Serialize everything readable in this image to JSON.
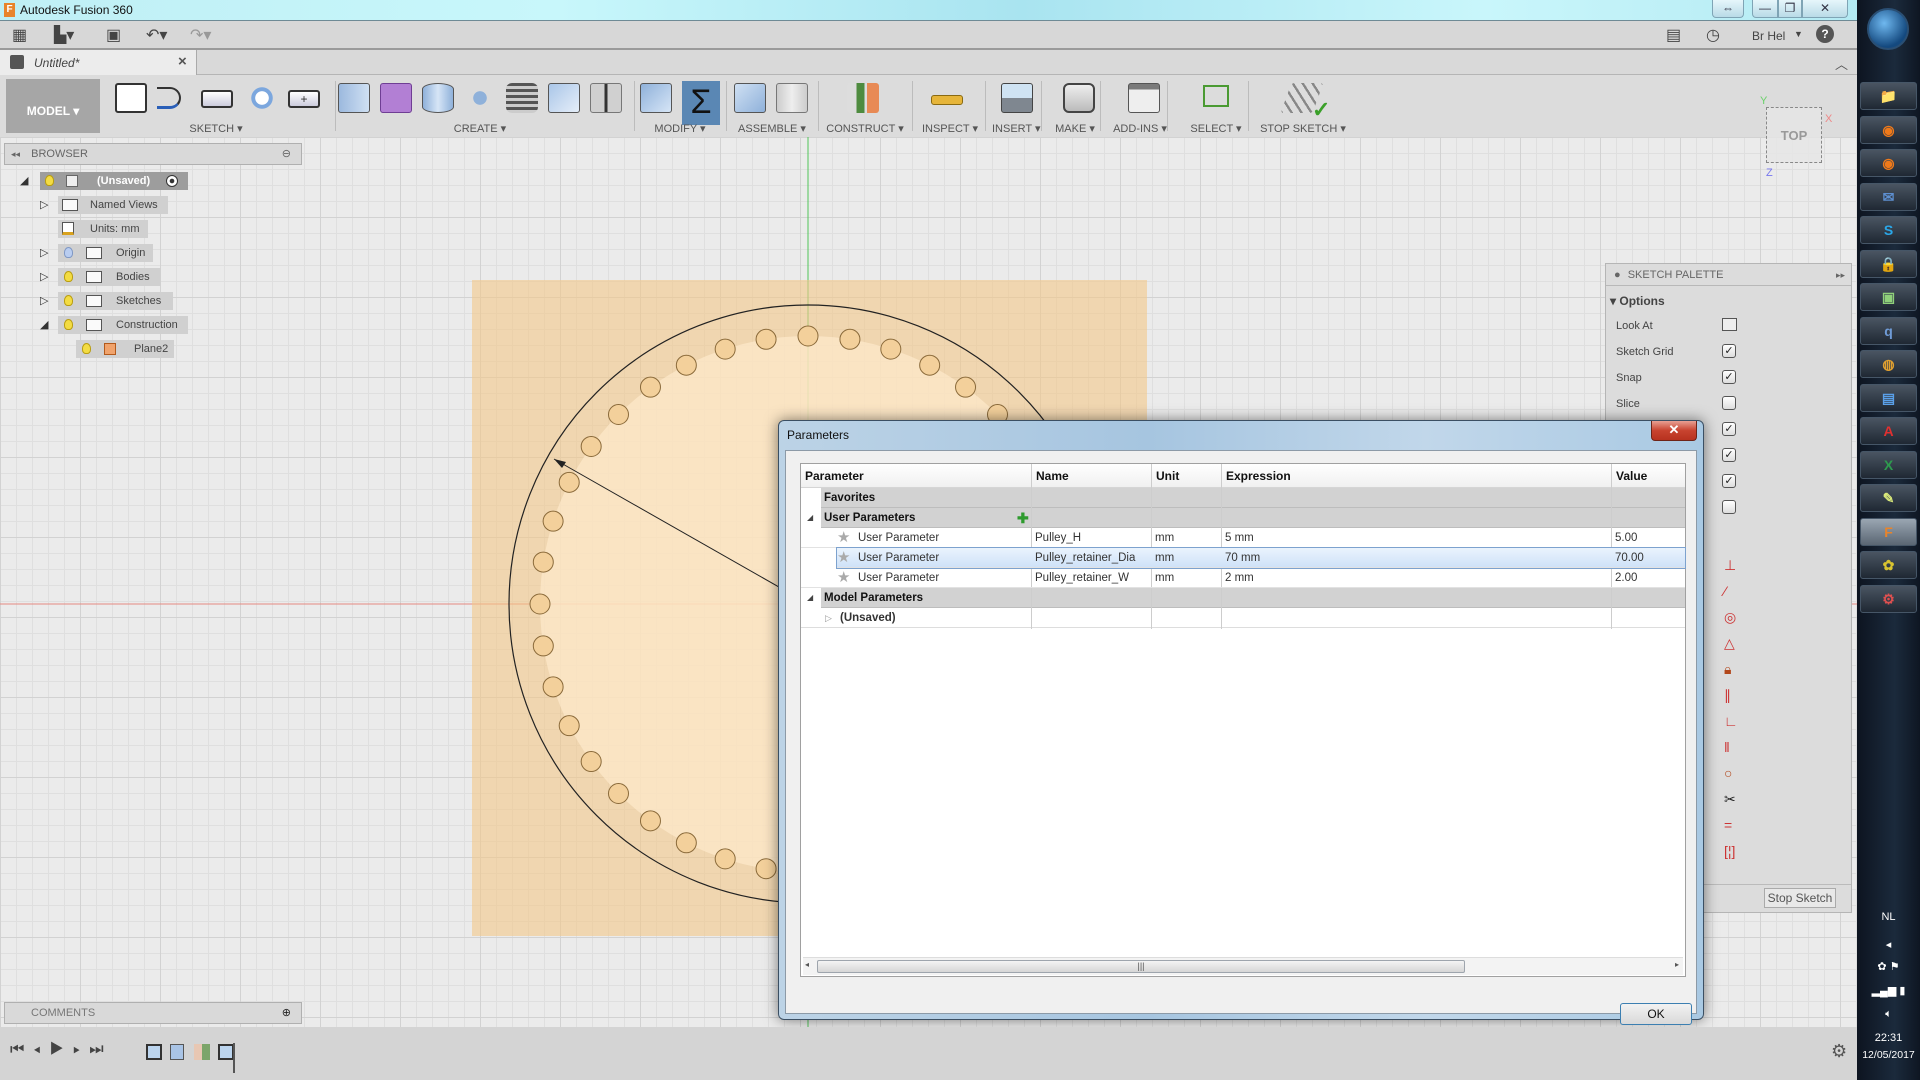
{
  "window": {
    "title": "Autodesk Fusion 360",
    "controls": {
      "restore_horizontal": "⇔",
      "minimize": "—",
      "maximize": "❐",
      "close": "✕"
    }
  },
  "appbar": {
    "user": "Br Hel",
    "icons": [
      "apps-grid-icon",
      "file-icon",
      "save-icon",
      "undo-icon",
      "redo-icon",
      "comment-icon",
      "history-icon",
      "help-icon"
    ]
  },
  "tab": {
    "label": "Untitled*",
    "close": "×"
  },
  "toolbar": {
    "workspace": "MODEL",
    "groups": [
      {
        "label": "SKETCH"
      },
      {
        "label": "CREATE"
      },
      {
        "label": "MODIFY"
      },
      {
        "label": "ASSEMBLE"
      },
      {
        "label": "CONSTRUCT"
      },
      {
        "label": "INSPECT"
      },
      {
        "label": "INSERT"
      },
      {
        "label": "MAKE"
      },
      {
        "label": "ADD-INS"
      },
      {
        "label": "SELECT"
      },
      {
        "label": "STOP SKETCH"
      }
    ],
    "active_tool": "Parameters (Σ)"
  },
  "browser": {
    "title": "BROWSER",
    "items": [
      {
        "label": "(Unsaved)",
        "level": 0,
        "expanded": true
      },
      {
        "label": "Named Views",
        "level": 1
      },
      {
        "label": "Units: mm",
        "level": 1
      },
      {
        "label": "Origin",
        "level": 1
      },
      {
        "label": "Bodies",
        "level": 1
      },
      {
        "label": "Sketches",
        "level": 1
      },
      {
        "label": "Construction",
        "level": 1,
        "expanded": true
      },
      {
        "label": "Plane2",
        "level": 2
      }
    ]
  },
  "viewcube": {
    "face": "TOP",
    "axes": {
      "x": "X",
      "y": "Y",
      "z": "Z"
    }
  },
  "sketch_palette": {
    "title": "SKETCH PALETTE",
    "section": "Options",
    "options": [
      {
        "label": "Look At",
        "type": "button"
      },
      {
        "label": "Sketch Grid",
        "checked": true
      },
      {
        "label": "Snap",
        "checked": true
      },
      {
        "label": "Slice",
        "checked": false
      },
      {
        "label": "",
        "checked": true
      },
      {
        "label": "",
        "checked": true
      },
      {
        "label": "",
        "checked": true
      },
      {
        "label": "",
        "checked": false
      }
    ],
    "constraints": [
      "coincident-icon",
      "collinear-icon",
      "concentric-icon",
      "midpoint-icon",
      "fix-icon",
      "parallel-icon",
      "perpendicular-icon",
      "horizontal-vertical-icon",
      "tangent-icon",
      "smooth-icon",
      "equal-icon",
      "symmetry-icon"
    ],
    "stop_button": "Stop Sketch"
  },
  "dialog": {
    "title": "Parameters",
    "close": "✕",
    "columns": [
      "Parameter",
      "Name",
      "Unit",
      "Expression",
      "Value"
    ],
    "groups": {
      "favorites": "Favorites",
      "user": "User Parameters",
      "model": "Model Parameters"
    },
    "user_params": [
      {
        "parameter": "User Parameter",
        "name": "Pulley_H",
        "unit": "mm",
        "expression": "5 mm",
        "value": "5.00"
      },
      {
        "parameter": "User Parameter",
        "name": "Pulley_retainer_Dia",
        "unit": "mm",
        "expression": "70 mm",
        "value": "70.00",
        "selected": true
      },
      {
        "parameter": "User Parameter",
        "name": "Pulley_retainer_W",
        "unit": "mm",
        "expression": "2 mm",
        "value": "2.00"
      }
    ],
    "model_params": [
      {
        "parameter": "(Unsaved)"
      }
    ],
    "scroll_grip": "|||",
    "ok": "OK"
  },
  "comments": {
    "title": "COMMENTS"
  },
  "timeline": {
    "controls": [
      "first-icon",
      "previous-icon",
      "play-icon",
      "next-icon",
      "last-icon"
    ],
    "features": [
      "sketch-feature-icon",
      "extrude-feature-icon",
      "plane-feature-icon",
      "sketch-feature-icon"
    ]
  },
  "taskbar": {
    "apps": [
      "explorer",
      "firefox",
      "firefox",
      "thunderbird",
      "skype",
      "keepass",
      "monitor",
      "qbittorrent",
      "chrome",
      "remote-desktop",
      "acrobat",
      "excel",
      "notepad",
      "fusion360",
      "paint",
      "speedfan"
    ],
    "language": "NL",
    "time": "22:31",
    "date": "12/05/2017"
  }
}
